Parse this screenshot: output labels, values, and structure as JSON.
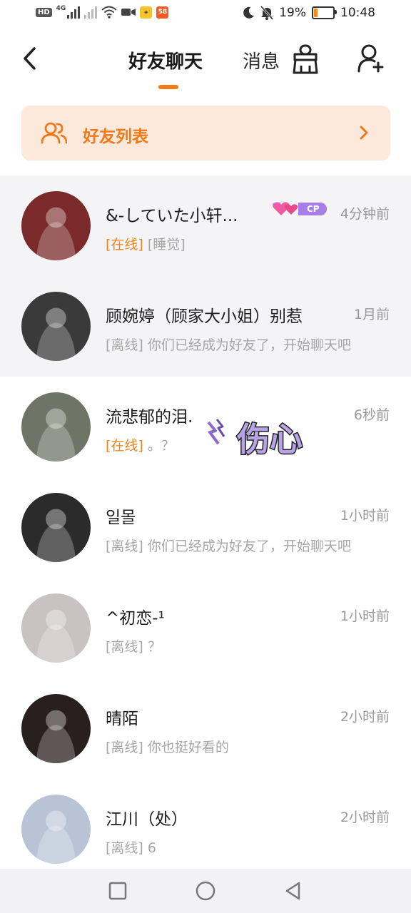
{
  "status_bar": {
    "left_tag": "HD",
    "net_label": "4G",
    "app_icon_1": "sticker-app",
    "app_icon_2": "58",
    "battery": "19%",
    "time": "10:48",
    "battery_level": 0.19
  },
  "header": {
    "tab_friends": "好友聊天",
    "tab_messages": "消息",
    "active_tab": "tab_friends"
  },
  "banner": {
    "label": "好友列表",
    "icon": "friends-icon"
  },
  "chats": [
    {
      "name": "&-していた小轩...",
      "time": "4分钟前",
      "status": "[在线]",
      "status_online": true,
      "message": "[睡觉]",
      "badge": "CP",
      "pinned": true,
      "avatar_color": "#7a2a2a"
    },
    {
      "name": "顾婉婷（顾家大小姐）别惹",
      "time": "1月前",
      "status": "[离线]",
      "status_online": false,
      "message": "你们已经成为好友了，开始聊天吧",
      "pinned": true,
      "avatar_color": "#3a3a3a"
    },
    {
      "name": "流悲郁的泪.",
      "time": "6秒前",
      "status": "[在线]",
      "status_online": true,
      "message": "。？",
      "sticker": "伤心",
      "pinned": false,
      "avatar_color": "#6e7566"
    },
    {
      "name": "일몰",
      "time": "1小时前",
      "status": "[离线]",
      "status_online": false,
      "message": "你们已经成为好友了，开始聊天吧",
      "pinned": false,
      "avatar_color": "#2b2b2b"
    },
    {
      "name": "^初恋-¹",
      "time": "1小时前",
      "status": "[离线]",
      "status_online": false,
      "message": "？",
      "pinned": false,
      "avatar_color": "#c9c2c2"
    },
    {
      "name": "晴陌",
      "time": "2小时前",
      "status": "[离线]",
      "status_online": false,
      "message": "你也挺好看的",
      "pinned": false,
      "avatar_color": "#2a1f1f"
    },
    {
      "name": "江川（处）",
      "time": "2小时前",
      "status": "[离线]",
      "status_online": false,
      "message": "6",
      "pinned": false,
      "avatar_color": "#b8c4d6"
    }
  ],
  "nav": {
    "recent": "square-icon",
    "home": "circle-icon",
    "back": "triangle-back-icon"
  }
}
